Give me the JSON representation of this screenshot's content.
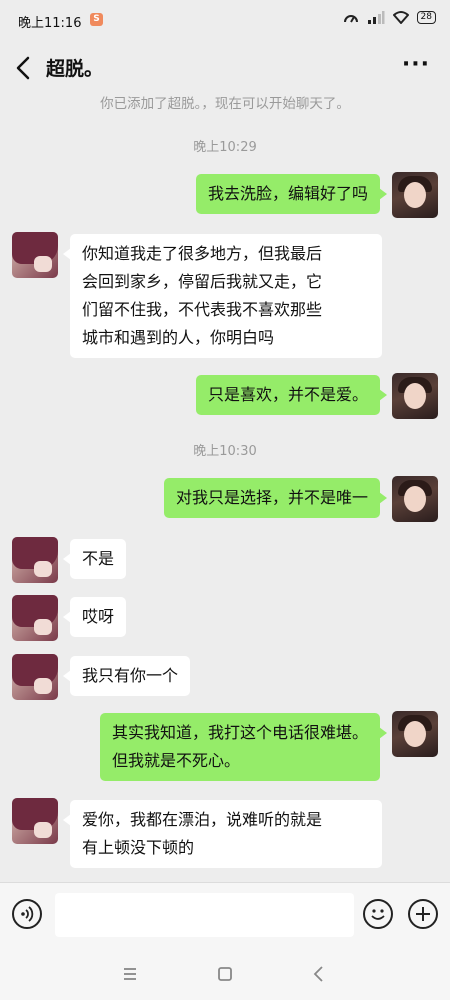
{
  "status_bar": {
    "time": "晚上11:16",
    "battery": "28"
  },
  "header": {
    "title": "超脱。"
  },
  "system_notice": "你已添加了超脱。，现在可以开始聊天了。",
  "timestamps": [
    "晚上10:29",
    "晚上10:30"
  ],
  "messages": [
    {
      "sender": "me",
      "text": "我去洗脸，编辑好了吗"
    },
    {
      "sender": "other",
      "text": "你知道我走了很多地方，但我最后\n会回到家乡，停留后我就又走，它\n们留不住我，不代表我不喜欢那些\n城市和遇到的人，你明白吗"
    },
    {
      "sender": "me",
      "text": "只是喜欢，并不是爱。"
    },
    {
      "sender": "me",
      "text": "对我只是选择，并不是唯一"
    },
    {
      "sender": "other",
      "text": "不是"
    },
    {
      "sender": "other",
      "text": "哎呀"
    },
    {
      "sender": "other",
      "text": "我只有你一个"
    },
    {
      "sender": "me",
      "text": "其实我知道，我打这个电话很难堪。\n但我就是不死心。"
    },
    {
      "sender": "other",
      "text": "爱你，我都在漂泊，说难听的就是\n有上顿没下顿的"
    }
  ],
  "input": {
    "placeholder": ""
  },
  "icons": {
    "back": "chevron-left-icon",
    "more": "more-dots-icon",
    "voice": "voice-icon",
    "emoji": "emoji-icon",
    "plus": "plus-icon",
    "menu": "menu-icon",
    "home": "home-icon",
    "nav_back": "back-triangle-icon"
  },
  "colors": {
    "me_bubble": "#95ec69",
    "other_bubble": "#ffffff",
    "background": "#ededed"
  }
}
